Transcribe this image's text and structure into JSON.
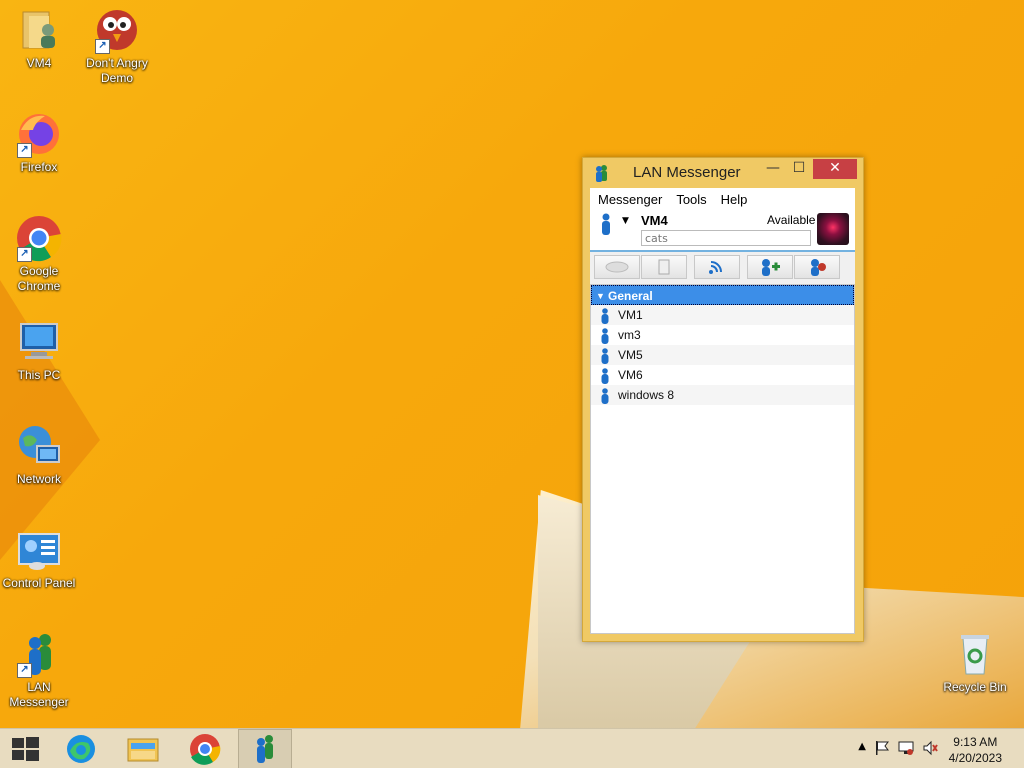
{
  "desktop": {
    "icons": [
      {
        "label_lines": [
          "VM4"
        ],
        "name": "vm4-folder"
      },
      {
        "label_lines": [
          "Don't Angry",
          "Demo"
        ],
        "name": "dont-angry-demo"
      },
      {
        "label_lines": [
          "Firefox"
        ],
        "name": "firefox"
      },
      {
        "label_lines": [
          "Google",
          "Chrome"
        ],
        "name": "google-chrome"
      },
      {
        "label_lines": [
          "This PC"
        ],
        "name": "this-pc"
      },
      {
        "label_lines": [
          "Network"
        ],
        "name": "network"
      },
      {
        "label_lines": [
          "Control Panel"
        ],
        "name": "control-panel"
      },
      {
        "label_lines": [
          "LAN",
          "Messenger"
        ],
        "name": "lan-messenger"
      },
      {
        "label_lines": [
          "Recycle Bin"
        ],
        "name": "recycle-bin"
      }
    ]
  },
  "window": {
    "title": "LAN Messenger",
    "controls": {
      "minimize": "—",
      "maximize": "☐",
      "close": "✕"
    },
    "menu": [
      "Messenger",
      "Tools",
      "Help"
    ],
    "user": {
      "name": "VM4",
      "status": "Available",
      "note": "cats"
    },
    "group": {
      "name": "General"
    },
    "contacts": [
      "VM1",
      "vm3",
      "VM5",
      "VM6",
      "windows 8"
    ]
  },
  "taskbar": {
    "clock": {
      "time": "9:13 AM",
      "date": "4/20/2023"
    }
  },
  "colors": {
    "accent": "#3c8ee8",
    "desktop": "#f7a80c",
    "close": "#c74044"
  }
}
